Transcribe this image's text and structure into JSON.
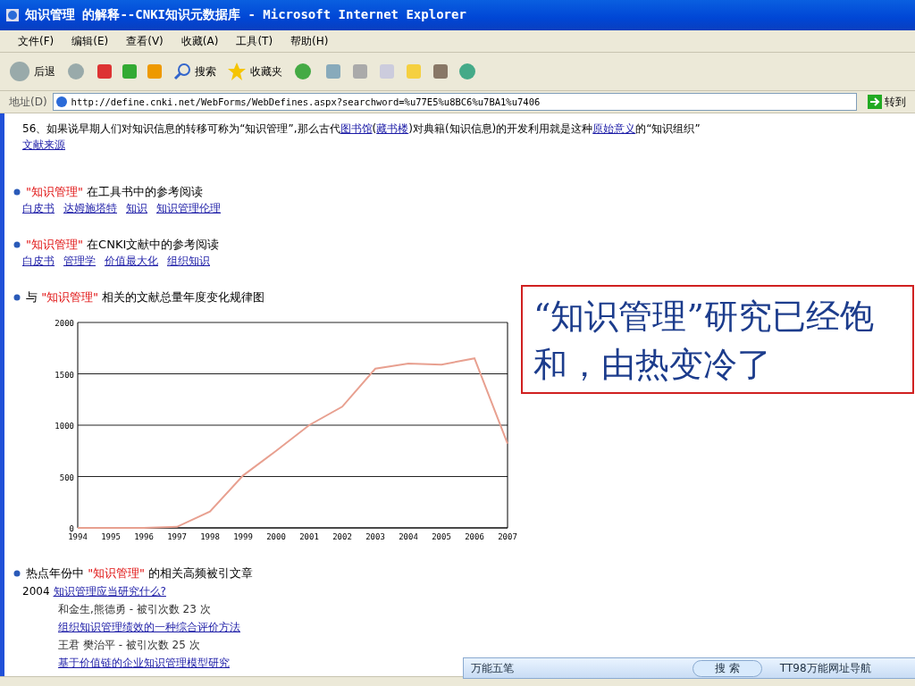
{
  "window": {
    "title": "知识管理 的解释--CNKI知识元数据库 - Microsoft Internet Explorer"
  },
  "menu": [
    "文件(F)",
    "编辑(E)",
    "查看(V)",
    "收藏(A)",
    "工具(T)",
    "帮助(H)"
  ],
  "toolbar": {
    "back": "后退",
    "search": "搜索",
    "favorites": "收藏夹"
  },
  "address": {
    "label": "地址(D)",
    "value": "http://define.cnki.net/WebForms/WebDefines.aspx?searchword=%u77E5%u8BC6%u7BA1%u7406",
    "go": "转到"
  },
  "entry": {
    "before": "56、如果说早期人们对知识信息的转移可称为“知识管理”,那么古代",
    "link1": "图书馆",
    "paren_open": "(",
    "link2": "藏书楼",
    "after": ")对典籍(知识信息)的开发利用就是这种",
    "link3": "原始意义",
    "tail": "的“知识组织”",
    "source": "文献来源"
  },
  "sections": [
    {
      "kind": "links",
      "term": "\"知识管理\"",
      "suffix": " 在工具书中的参考阅读",
      "links": [
        "白皮书",
        "达姆施塔特",
        "知识",
        "知识管理伦理"
      ]
    },
    {
      "kind": "links",
      "term": "\"知识管理\"",
      "suffix": " 在CNKI文献中的参考阅读",
      "links": [
        "白皮书",
        "管理学",
        "价值最大化",
        "组织知识"
      ]
    },
    {
      "kind": "chart",
      "prefix": "与 ",
      "term": "\"知识管理\"",
      "suffix": " 相关的文献总量年度变化规律图",
      "chart_data": {
        "type": "line",
        "categories": [
          "1994",
          "1995",
          "1996",
          "1997",
          "1998",
          "1999",
          "2000",
          "2001",
          "2002",
          "2003",
          "2004",
          "2005",
          "2006",
          "2007"
        ],
        "series": [
          {
            "color": "#e8a090",
            "values": [
              0,
              0,
              0,
              10,
              160,
              510,
              750,
              1000,
              1180,
              1550,
              1600,
              1590,
              1650,
              820
            ]
          }
        ],
        "ylim": [
          0,
          2000
        ],
        "yticks": [
          0,
          500,
          1000,
          1500,
          2000
        ],
        "grid": true
      }
    },
    {
      "kind": "articles",
      "prefix": "热点年份中 ",
      "term": "\"知识管理\"",
      "suffix": " 的相关高频被引文章",
      "year": "2004",
      "articles": [
        {
          "title": "知识管理应当研究什么?",
          "meta": "和金生,熊德勇 - 被引次数 23 次"
        },
        {
          "title": "组织知识管理绩效的一种综合评价方法",
          "meta": "王君  樊治平 - 被引次数 25 次"
        },
        {
          "title": "基于价值链的企业知识管理模型研究"
        }
      ]
    }
  ],
  "annotation": "“知识管理”研究已经饱和，由热变冷了",
  "ime_bar": {
    "tab": "万能五笔",
    "search": "搜 索",
    "nav": "TT98万能网址导航"
  }
}
